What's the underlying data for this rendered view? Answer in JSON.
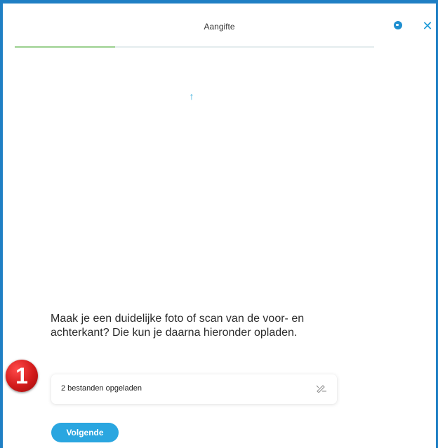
{
  "header": {
    "title": "Aangifte",
    "help_icon": "info-dot-icon",
    "close_icon": "close-icon",
    "close_glyph": "✕"
  },
  "progress": {
    "fraction": 0.28,
    "fill_color": "#9bd08f",
    "track_color": "#e3ecee"
  },
  "upload": {
    "arrow_glyph": "↑",
    "arrow_icon": "upload-arrow-icon"
  },
  "main": {
    "instruction": "Maak je een duidelijke foto of scan van de voor- en achterkant? Die kun je daarna hieronder opladen.",
    "files_card": {
      "label": "2 bestanden opgeladen",
      "icon": "edit-pencil-icon"
    },
    "badge_number": "1",
    "next_button": "Volgende"
  },
  "colors": {
    "frame_border": "#1f7fc4",
    "accent": "#2aa6e0",
    "badge_red": "#d11a1a"
  }
}
